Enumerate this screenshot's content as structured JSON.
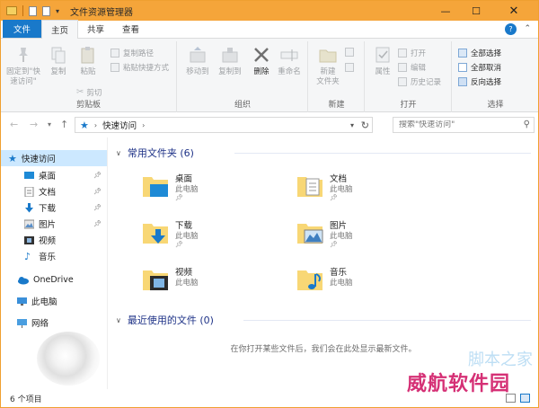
{
  "window": {
    "title": "文件资源管理器",
    "min_glyph": "—",
    "max_glyph": "☐",
    "close_glyph": "✕"
  },
  "ribbon_tabs": [
    "文件",
    "主页",
    "共享",
    "查看"
  ],
  "ribbon": {
    "clipboard": {
      "label": "剪贴板",
      "pin": "固定到\"快速访问\"",
      "copy": "复制",
      "paste": "粘贴",
      "copy_path": "复制路径",
      "paste_shortcut": "粘贴快捷方式",
      "cut": "剪切"
    },
    "organize": {
      "label": "组织",
      "move_to": "移动到",
      "copy_to": "复制到",
      "delete": "删除",
      "rename": "重命名"
    },
    "new": {
      "label": "新建",
      "new_folder": "新建\n文件夹"
    },
    "open": {
      "label": "打开",
      "properties": "属性",
      "open": "打开",
      "edit": "编辑",
      "history": "历史记录"
    },
    "select": {
      "label": "选择",
      "select_all": "全部选择",
      "select_none": "全部取消",
      "invert": "反向选择"
    }
  },
  "address": {
    "path": "快速访问",
    "search_placeholder": "搜索\"快速访问\""
  },
  "nav": {
    "quick_access": "快速访问",
    "items": [
      "桌面",
      "文档",
      "下载",
      "图片",
      "视频",
      "音乐"
    ],
    "onedrive": "OneDrive",
    "this_pc": "此电脑",
    "network": "网络"
  },
  "content": {
    "frequent_header": "常用文件夹 (6)",
    "folders": [
      {
        "name": "桌面",
        "location": "此电脑"
      },
      {
        "name": "文档",
        "location": "此电脑"
      },
      {
        "name": "下载",
        "location": "此电脑"
      },
      {
        "name": "图片",
        "location": "此电脑"
      },
      {
        "name": "视频",
        "location": "此电脑"
      },
      {
        "name": "音乐",
        "location": "此电脑"
      }
    ],
    "recent_header": "最近使用的文件 (0)",
    "recent_empty": "在你打开某些文件后，我们会在此处显示最新文件。"
  },
  "status": {
    "items_count": "6 个项目"
  },
  "watermark": {
    "text": "威航软件园",
    "overlay": "脚本之家"
  },
  "colors": {
    "title_bar": "#f5a53a",
    "file_tab": "#1979ca",
    "selected": "#cce8ff",
    "section_header": "#1e3287",
    "watermark": "#d11a67"
  }
}
